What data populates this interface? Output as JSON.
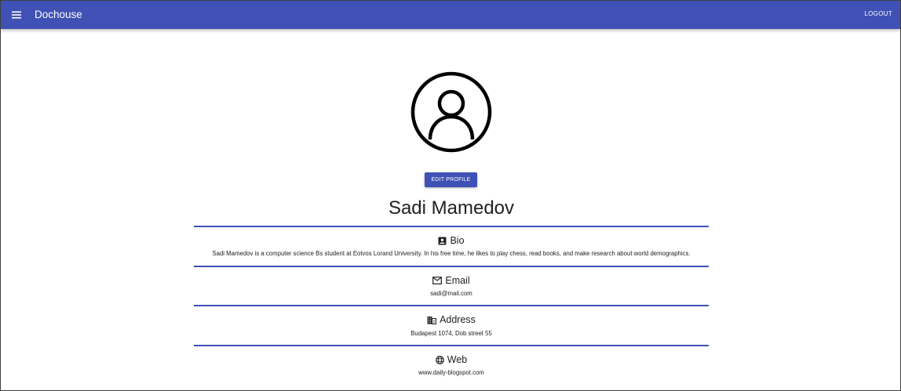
{
  "appbar": {
    "title": "Dochouse",
    "menu_icon": "menu-icon",
    "logout_label": "LOGOUT",
    "color": "#3f51b5"
  },
  "profile": {
    "avatar_icon": "account-circle-icon",
    "edit_label": "EDIT PROFILE",
    "name": "Sadi Mamedov",
    "sections": [
      {
        "icon": "contact-card-icon",
        "title": "Bio",
        "text": "Sadi Mamedov is a computer science Bs student at Eotvos Lorand University. In his free time, he likes to play chess, read books, and make research about world demographics."
      },
      {
        "icon": "mail-icon",
        "title": "Email",
        "text": "sadi@mail.com"
      },
      {
        "icon": "building-icon",
        "title": "Address",
        "text": "Budapest 1074, Dob street 55"
      },
      {
        "icon": "globe-icon",
        "title": "Web",
        "text": "www.daily-blogspot.com"
      }
    ]
  }
}
